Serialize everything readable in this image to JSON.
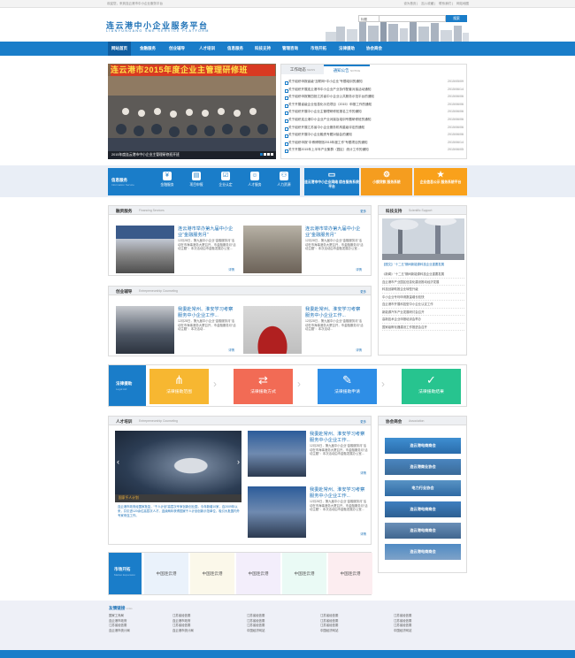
{
  "topbar": {
    "welcome": "欢迎您，来到连云港市中小企业服务平台",
    "links": [
      "设为首页",
      "加入收藏",
      "联系我们",
      "网站地图"
    ]
  },
  "header": {
    "title_cn": "连云港中小企业服务平台",
    "title_en": "LIANYUNGANG SME SERVICE PLATFORM"
  },
  "search": {
    "type": "标题",
    "placeholder": "",
    "button": "搜索"
  },
  "nav": [
    "网站首页",
    "金融服务",
    "创业辅导",
    "人才培训",
    "信息服务",
    "科技支持",
    "管理咨询",
    "市场开拓",
    "法律援助",
    "协会商会"
  ],
  "banner": {
    "slogan": "连云港市2015年度企业主管理研修班",
    "caption": "2015年度连云港市中小企业主管理研修班开班"
  },
  "news": {
    "tab_work": "工作动态",
    "tab_work_en": "NEWS",
    "tab_notice": "通知公告",
    "tab_notice_en": "NOTICE",
    "items": [
      {
        "title": "关于组织申报省级“互联网+中小企业”专题培训的通知",
        "date": "2015/05/09"
      },
      {
        "title": "关于组织开展连云港市中小企业产业协作配套对接活动通知",
        "date": "2015/06/14"
      },
      {
        "title": "关于组织申报第四批江苏省中小企业公共服务示范平台的通知",
        "date": "2015/06/06"
      },
      {
        "title": "关于开展省级企业信息化示范项目（2015）申报工作的通知",
        "date": "2015/06/06"
      },
      {
        "title": "关于组织开展中小企业主管理研修班报名工作的通知",
        "date": "2015/06/06"
      },
      {
        "title": "关于组织连云港中小企业产业对接及培训专题研修班的通知",
        "date": "2015/06/06"
      },
      {
        "title": "关于组织开展江苏省中小企业服务机构星级评定的通知",
        "date": "2015/06/06"
      },
      {
        "title": "关于组织开展中小企业融资专题对接会的通知",
        "date": "2015/06/06"
      },
      {
        "title": "关于组织申报“中博博物馆2015年度工作”专题项目的通知",
        "date": "2015/06/14"
      },
      {
        "title": "关于开展2015年上半年产业集群（园区）统计工作的通知",
        "date": "2015/06/05"
      }
    ]
  },
  "services": {
    "label": "信息服务",
    "label_en": "Information Service",
    "items": [
      "金融服务",
      "项目申报",
      "企业认定",
      "人才服务",
      "人力资源"
    ],
    "promos": [
      {
        "text": "连云港市中小企业网络 综合服务系统平台",
        "color": "#1a7dc9"
      },
      {
        "text": "小额贷款 服务系统",
        "color": "#f59d1f"
      },
      {
        "text": "企业信息公示 服务系统平台",
        "color": "#f9a11b"
      }
    ]
  },
  "finance": {
    "title": "融资服务",
    "title_en": "Financing Services",
    "more": "更多",
    "cards": [
      {
        "title": "连云港市举办第九届中小企业“金融服务月”",
        "body": "12月28日，第九届中小企业“金融服务月”活动在市海事港务大厦召开，市金融服务月“活动主题”：本次活动由市金融发展办公室...",
        "more": "详情"
      },
      {
        "title": "连云港市举办第九届中小企业“金融服务月”",
        "body": "12月28日，第九届中小企业“金融服务月”活动在市海事港务大厦召开，市金融服务月“活动主题”：本次活动由市金融发展办公室...",
        "more": "详情"
      }
    ]
  },
  "tech": {
    "title": "科技支持",
    "title_en": "Scientific Support",
    "more": "更多",
    "headline": "【图文】“十二五”期间新能源科技企业重要发展",
    "items": [
      "《新闻》“十二五”期间新能源科技企业重要发展",
      "连云港市产业园区信息化建设推动经济发展",
      "科技创新助推企业转型升级",
      "中小企业专利申请数量增长较快",
      "连云港市开展科技型中小企业认定工作",
      "新能源汽车产业发展研讨会召开",
      "高新技术企业申报培训会举办",
      "国家级孵化器建设工作推进会召开"
    ]
  },
  "startup": {
    "title": "创业辅导",
    "title_en": "Entrepreneurship Counseling",
    "more": "更多",
    "cards": [
      {
        "title": "我委赴常州、淮安学习考察服务中小企业工作...",
        "body": "12月28日，第九届中小企业“金融服务月”活动在市海事港务大厦召开，市金融服务月“活动主题”：本次活动...",
        "more": "详情"
      },
      {
        "title": "我委赴常州、淮安学习考察服务中小企业工作...",
        "body": "12月28日，第九届中小企业“金融服务月”活动在市海事港务大厦召开，市金融服务月“活动主题”：本次活动...",
        "more": "详情"
      }
    ]
  },
  "law": {
    "label": "法律援助",
    "label_en": "Legal Aid",
    "items": [
      {
        "text": "法律援助范围",
        "color": "#f7b731"
      },
      {
        "text": "法律援助方式",
        "color": "#f26b55"
      },
      {
        "text": "法律援助申请",
        "color": "#2e8ee6"
      },
      {
        "text": "法律援助结果",
        "color": "#27c48f"
      }
    ]
  },
  "talent": {
    "title": "人才培训",
    "title_en": "Entrepreneurship Counseling",
    "more": "更多",
    "caption": "国家千人计划",
    "text": "连云港市政府经国家批复，“千人计划”高层次专家创新创业园，今年新增10家，自2009年以来，共引进120余位高层次人才，连续两年获得国家千人计划创新示范单位，吸引大批国内外专家来连工作。",
    "cards": [
      {
        "title": "我委赴常州、淮安学习考察服务中小企业工作...",
        "body": "12月28日，第九届中小企业“金融服务月”活动在市海事港务大厦召开，市金融服务月“活动主题”：本次活动由市金融发展办公室...",
        "more": "详情"
      },
      {
        "title": "我委赴常州、淮安学习考察服务中小企业工作...",
        "body": "12月28日，第九届中小企业“金融服务月”活动在市海事港务大厦召开，市金融服务月“活动主题”：本次活动由市金融发展办公室...",
        "more": "详情"
      }
    ]
  },
  "coop": {
    "title": "协会商会",
    "title_en": "Association",
    "items": [
      "连云港电商商会",
      "连云港商业协会",
      "电力行业协会",
      "连云港电商商会",
      "连云港电商商会",
      "连云港电商商会"
    ]
  },
  "market": {
    "label": "市场开拓",
    "label_en": "Market Expansion",
    "items": [
      "中国连云港",
      "中国连云港",
      "中国连云港",
      "中国连云港",
      "中国连云港"
    ]
  },
  "friend_links": {
    "title": "友情链接",
    "title_en": "Links",
    "columns": [
      [
        "国家工商局",
        "连云港市政府",
        "江苏省经信委",
        "连云港市统计局"
      ],
      [
        "江苏省经信委",
        "连云港市政府",
        "江苏省经信委",
        "连云港市统计局"
      ],
      [
        "江苏省经信委",
        "江苏省经信委",
        "江苏省经信委",
        "中国经济网站"
      ],
      [
        "江苏省经信委",
        "江苏省经信委",
        "江苏省经信委",
        "中国经济网站"
      ],
      [
        "江苏省经信委",
        "江苏省经信委",
        "江苏省经信委",
        "中国经济网站"
      ]
    ]
  }
}
